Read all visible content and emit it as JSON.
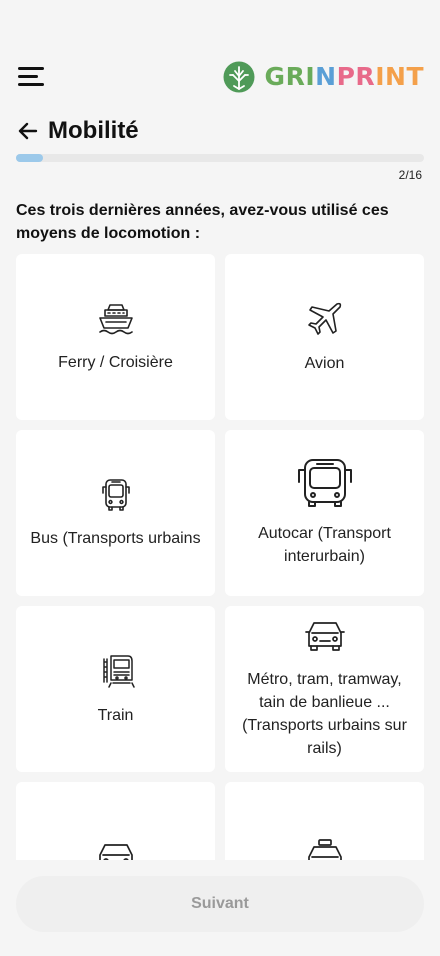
{
  "header": {
    "brand": {
      "letters": [
        "G",
        "R",
        "I",
        "N",
        "P",
        "R",
        "I",
        "N",
        "T"
      ],
      "colors": [
        "#6aab5a",
        "#6aab5a",
        "#6aab5a",
        "#5a9fd6",
        "#e86a8a",
        "#e86a8a",
        "#f4a04a",
        "#f4a04a",
        "#f4a04a"
      ]
    },
    "brand_color": "#4f9a58"
  },
  "title": "Mobilité",
  "progress": {
    "current": 2,
    "total": 16,
    "label": "2/16",
    "fill_percent": 6.5
  },
  "question": "Ces trois dernières années, avez-vous utilisé ces moyens de locomotion :",
  "options": [
    {
      "label": "Ferry / Croisière",
      "icon": "ship-icon"
    },
    {
      "label": "Avion",
      "icon": "airplane-icon"
    },
    {
      "label": "Bus (Transports urbains",
      "icon": "bus-icon"
    },
    {
      "label": "Autocar (Transport interurbain)",
      "icon": "coach-icon"
    },
    {
      "label": "Train",
      "icon": "train-icon"
    },
    {
      "label": "Métro, tram, tramway, tain de banlieue ... (Transports urbains sur rails)",
      "icon": "car-front-icon"
    },
    {
      "label": "",
      "icon": "car-icon"
    },
    {
      "label": "",
      "icon": "taxi-icon"
    }
  ],
  "next_button": "Suivant"
}
